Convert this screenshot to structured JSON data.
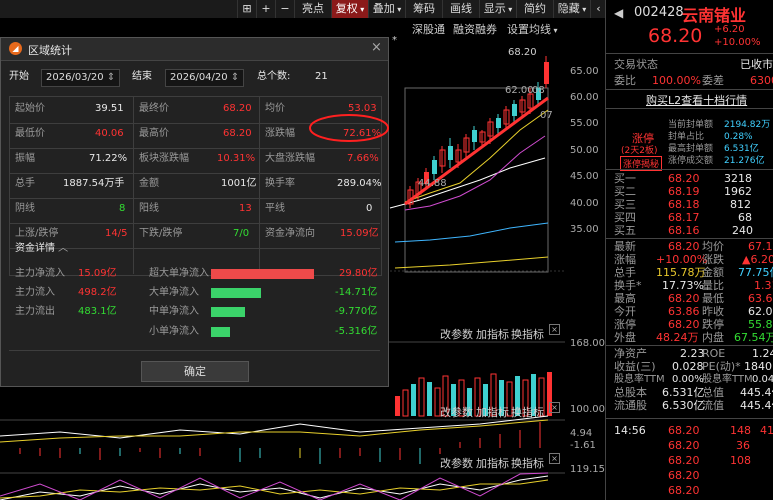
{
  "toolbar": {
    "items": [
      "亮点",
      "复权",
      "叠加",
      "筹码",
      "画线",
      "显示",
      "简约",
      "隐藏"
    ],
    "icons": [
      "align-icon",
      "zoom-in-icon",
      "zoom-out-icon",
      "chevron-left-icon"
    ]
  },
  "chart": {
    "top_tabs": [
      "深股通",
      "融资融券",
      "设置均线"
    ],
    "price_labels": [
      "68.20",
      "62.00",
      "44.88"
    ],
    "y_axis": [
      "65.00",
      "60.00",
      "55.00",
      "50.00",
      "45.00",
      "40.00",
      "35.00"
    ],
    "volume_tabs": [
      "改参数",
      "加指标",
      "换指标"
    ],
    "volume_axis": [
      "168.00",
      "100.00"
    ],
    "macd_axis": [
      "4.94",
      "-1.61"
    ],
    "kdj_axis": [
      "119.15"
    ],
    "star": "*",
    "partial_label_1": "08",
    "partial_label_2": "07"
  },
  "dialog": {
    "title": "区域统计",
    "start_label": "开始",
    "start_date": "2026/03/20",
    "end_label": "结束",
    "end_date": "2026/04/20",
    "count_label": "总个数:",
    "count_value": "21",
    "stats": [
      [
        "起始价",
        "39.51",
        "最终价",
        "68.20",
        "均价",
        "53.03"
      ],
      [
        "最低价",
        "40.06",
        "最高价",
        "68.20",
        "涨跌幅",
        "72.61%"
      ],
      [
        "振幅",
        "71.22%",
        "板块涨跌幅",
        "10.31%",
        "大盘涨跌幅",
        "7.66%"
      ],
      [
        "总手",
        "1887.54万手",
        "金额",
        "1001亿",
        "换手率",
        "289.04%"
      ],
      [
        "阴线",
        "8",
        "阳线",
        "13",
        "平线",
        "0"
      ],
      [
        "上涨/跌停",
        "14/5",
        "下跌/跌停",
        "7/0",
        "资金净流向",
        "15.09亿"
      ]
    ],
    "fund_header": "资金详情",
    "fund_left": [
      [
        "主力净流入",
        "15.09亿"
      ],
      [
        "主力流入",
        "498.2亿"
      ],
      [
        "主力流出",
        "483.1亿"
      ]
    ],
    "fund_right": [
      [
        "超大单净流入",
        "29.80亿",
        1.0
      ],
      [
        "大单净流入",
        "-14.71亿",
        0.49
      ],
      [
        "中单净流入",
        "-9.770亿",
        0.33
      ],
      [
        "小单净流入",
        "-5.316亿",
        0.18
      ]
    ],
    "confirm": "确定"
  },
  "quote": {
    "code": "002428",
    "name": "云南锗业",
    "price": "68.20",
    "change": "+6.20",
    "pct": "+10.00%",
    "status_label": "交易状态",
    "status_value": "已收市",
    "webi_label": "委比",
    "webi_value": "100.00%",
    "wecha_label": "委差",
    "wecha_value": "6300",
    "l2_link": "购买L2查看十档行情",
    "limit_badge": "涨停",
    "limit_days": "(2天2板)",
    "limit_reveal": "涨停揭秘",
    "seal": [
      [
        "当前封单额",
        "2194.82万"
      ],
      [
        "封单占比",
        "0.28%"
      ],
      [
        "最高封单额",
        "6.531亿"
      ],
      [
        "涨停成交额",
        "21.276亿"
      ]
    ],
    "sells": [
      [
        "卖五",
        "",
        ""
      ],
      [
        "卖四",
        "",
        ""
      ],
      [
        "卖三",
        "",
        ""
      ],
      [
        "卖二",
        "",
        ""
      ],
      [
        "卖一",
        "",
        ""
      ]
    ],
    "buys": [
      [
        "买一",
        "68.20",
        "3218"
      ],
      [
        "买二",
        "68.19",
        "1962"
      ],
      [
        "买三",
        "68.18",
        "812"
      ],
      [
        "买四",
        "68.17",
        "68"
      ],
      [
        "买五",
        "68.16",
        "240"
      ]
    ],
    "details": [
      [
        "最新",
        "68.20",
        "均价",
        "67.15"
      ],
      [
        "涨幅",
        "+10.00%",
        "涨跌",
        "▲6.20"
      ],
      [
        "总手",
        "115.78万",
        "金额",
        "77.75亿"
      ],
      [
        "换手*",
        "17.73%",
        "量比",
        "1.31"
      ],
      [
        "最高",
        "68.20",
        "最低",
        "63.68"
      ],
      [
        "今开",
        "63.86",
        "昨收",
        "62.00"
      ],
      [
        "涨停",
        "68.20",
        "跌停",
        "55.80"
      ],
      [
        "外盘",
        "48.24万",
        "内盘",
        "67.54万"
      ],
      [
        "净资产",
        "2.23",
        "ROE",
        "1.24%"
      ],
      [
        "收益(三)",
        "0.028",
        "PE(动)*",
        "1840.8"
      ],
      [
        "股息率TTM",
        "0.00%",
        "股息率TTM",
        "0.04%"
      ],
      [
        "总股本",
        "6.531亿",
        "总值",
        "445.4亿"
      ],
      [
        "流通股",
        "6.530亿",
        "流值",
        "445.4亿"
      ]
    ],
    "ticks": [
      [
        "14:56",
        "68.20",
        "148",
        "41"
      ],
      [
        "",
        "68.20",
        "36",
        ""
      ],
      [
        "",
        "68.20",
        "108",
        ""
      ],
      [
        "",
        "68.20",
        "",
        ""
      ],
      [
        "",
        "68.20",
        "",
        ""
      ]
    ]
  }
}
